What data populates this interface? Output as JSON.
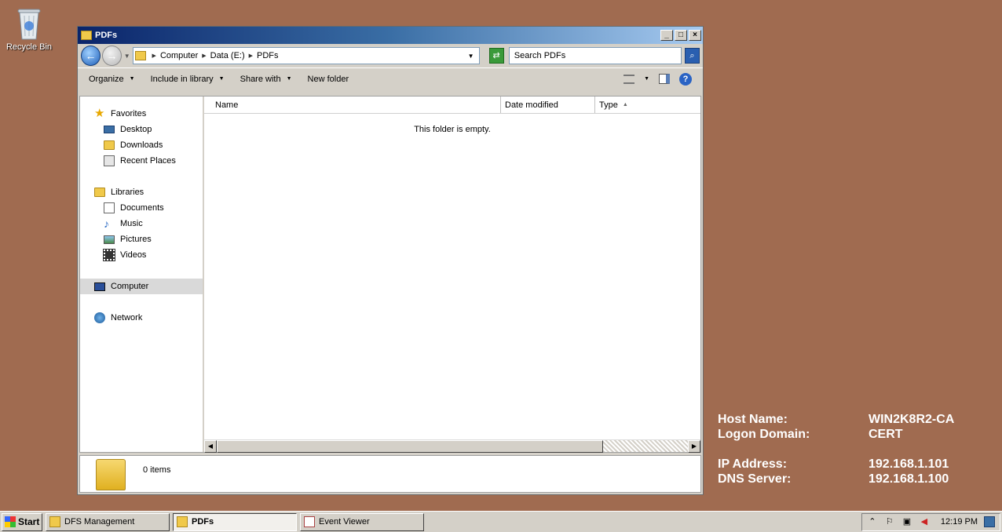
{
  "desktop": {
    "recycle_bin_label": "Recycle Bin"
  },
  "window": {
    "title": "PDFs",
    "address": {
      "crumbs": [
        "Computer",
        "Data (E:)",
        "PDFs"
      ]
    },
    "search_placeholder": "Search PDFs",
    "commands": {
      "organize": "Organize",
      "include_in_library": "Include in library",
      "share_with": "Share with",
      "new_folder": "New folder"
    },
    "nav": {
      "favorites": "Favorites",
      "desktop": "Desktop",
      "downloads": "Downloads",
      "recent_places": "Recent Places",
      "libraries": "Libraries",
      "documents": "Documents",
      "music": "Music",
      "pictures": "Pictures",
      "videos": "Videos",
      "computer": "Computer",
      "network": "Network"
    },
    "columns": {
      "name": "Name",
      "date_modified": "Date modified",
      "type": "Type"
    },
    "empty_message": "This folder is empty.",
    "details_count": "0 items"
  },
  "bginfo": {
    "host_name_label": "Host Name:",
    "host_name_value": "WIN2K8R2-CA",
    "logon_domain_label": "Logon Domain:",
    "logon_domain_value": "CERT",
    "ip_label": "IP Address:",
    "ip_value": "192.168.1.101",
    "dns_label": "DNS Server:",
    "dns_value": "192.168.1.100"
  },
  "taskbar": {
    "start_label": "Start",
    "tasks": [
      "DFS Management",
      "PDFs",
      "Event Viewer"
    ],
    "clock": "12:19 PM"
  }
}
